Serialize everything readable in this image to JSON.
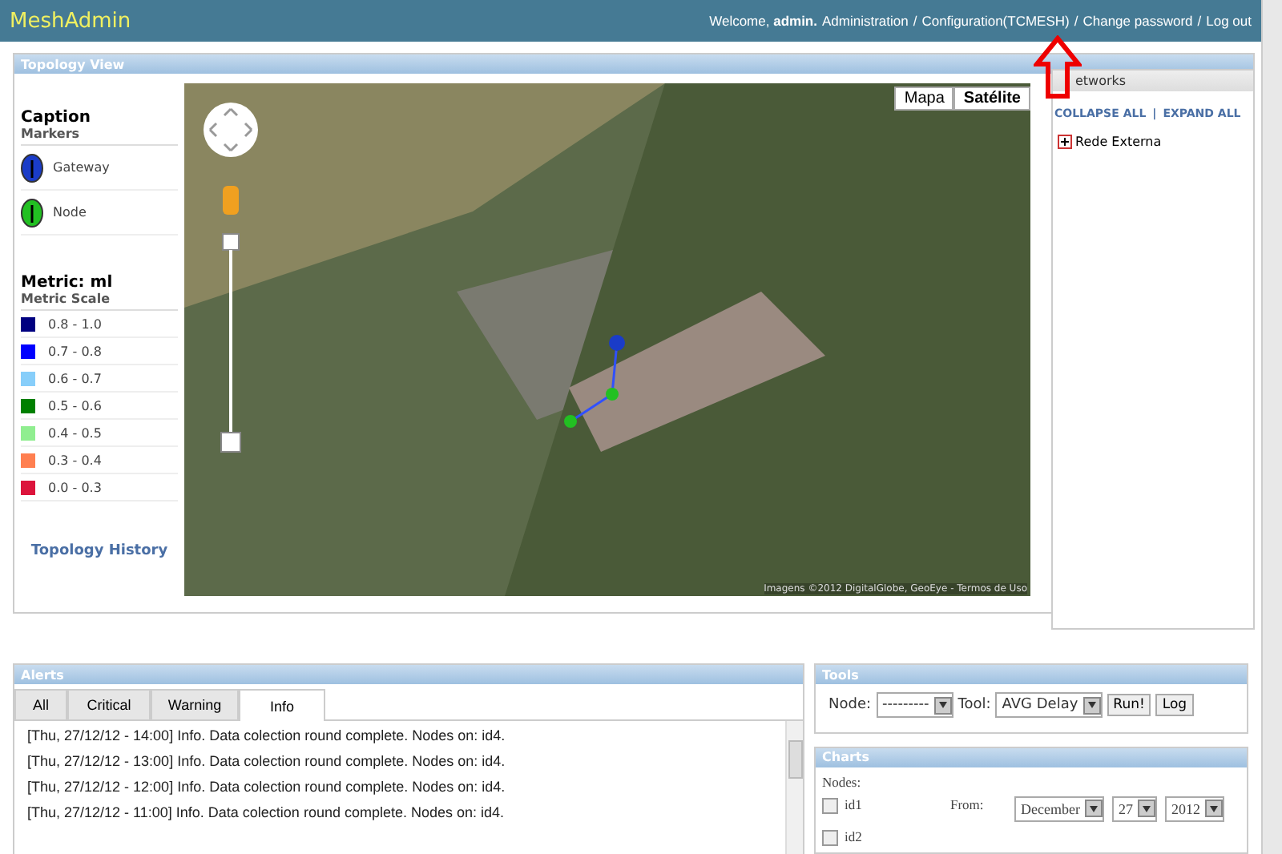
{
  "header": {
    "brand": "MeshAdmin",
    "welcome": "Welcome, **admin.**",
    "links": [
      "Administration",
      "Configuration(TCMESH)",
      "Change password",
      "Log out"
    ],
    "separator": "/"
  },
  "topology": {
    "title": "Topology View",
    "caption": {
      "title": "Caption",
      "markers_title": "Markers",
      "markers": [
        {
          "label": "Gateway",
          "color": "#1a3cc8"
        },
        {
          "label": "Node",
          "color": "#22c022"
        }
      ],
      "metric_title": "Metric: ml",
      "scale_title": "Metric Scale",
      "scale": [
        {
          "label": "0.8 - 1.0",
          "color": "#000080"
        },
        {
          "label": "0.7 - 0.8",
          "color": "#0000ff"
        },
        {
          "label": "0.6 - 0.7",
          "color": "#87cefa"
        },
        {
          "label": "0.5 - 0.6",
          "color": "#008000"
        },
        {
          "label": "0.4 - 0.5",
          "color": "#90ee90"
        },
        {
          "label": "0.3 - 0.4",
          "color": "#ff7f50"
        },
        {
          "label": "0.0 - 0.3",
          "color": "#dc143c"
        }
      ],
      "history_link": "Topology History"
    },
    "map": {
      "zoom": {
        "level": 0.05
      },
      "types": [
        {
          "label": "Mapa",
          "selected": false
        },
        {
          "label": "Satélite",
          "selected": true
        }
      ],
      "attribution": "Imagens ©2012 DigitalGlobe, GeoEye - Termos de Uso"
    },
    "networks": {
      "title": "etworks",
      "collapse": "COLLAPSE ALL",
      "expand": "EXPAND ALL",
      "divider": "|",
      "tree": [
        {
          "label": "Rede Externa",
          "expanded": false
        }
      ]
    }
  },
  "alerts": {
    "title": "Alerts",
    "tabs": [
      {
        "label": "All",
        "selected": false
      },
      {
        "label": "Critical",
        "selected": false
      },
      {
        "label": "Warning",
        "selected": false
      },
      {
        "label": "Info",
        "selected": true
      }
    ],
    "rows": [
      "[Thu, 27/12/12 - 14:00] Info. Data colection round complete. Nodes on: id4.",
      "[Thu, 27/12/12 - 13:00] Info. Data colection round complete. Nodes on: id4.",
      "[Thu, 27/12/12 - 12:00] Info. Data colection round complete. Nodes on: id4.",
      "[Thu, 27/12/12 - 11:00] Info. Data colection round complete. Nodes on: id4."
    ]
  },
  "tools": {
    "title": "Tools",
    "node_label": "Node:",
    "node_value": "---------",
    "tool_label": "Tool:",
    "tool_value": "AVG Delay",
    "buttons": [
      "Run!",
      "Log"
    ]
  },
  "charts": {
    "title": "Charts",
    "nodes_label": "Nodes:",
    "nodes": [
      {
        "label": "id1",
        "checked": false
      },
      {
        "label": "id2",
        "checked": false
      }
    ],
    "from": {
      "label": "From:",
      "month": "December",
      "day": "27",
      "year": "2012"
    }
  }
}
